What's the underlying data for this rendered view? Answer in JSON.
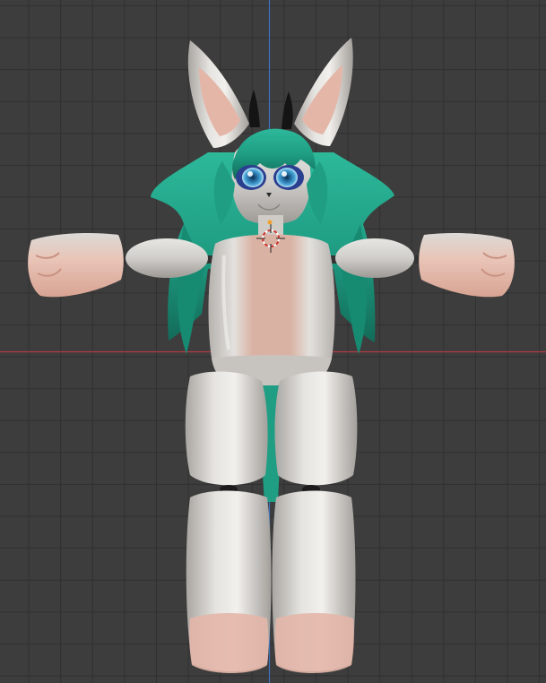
{
  "viewport": {
    "view": "front-orthographic",
    "grid": true,
    "colors": {
      "background": "#3d3d3d",
      "grid_line": "#303030",
      "x_axis": "#b23c46",
      "z_axis": "#3f6fbf",
      "cursor_red": "#d0342c",
      "cursor_white": "#ffffff"
    }
  },
  "model": {
    "description_colors": {
      "body_white": "#dcdad6",
      "body_shade": "#a9a6a2",
      "skin_pink": "#e6b7a8",
      "hair_teal": "#1f9e84",
      "hair_dark": "#126b58",
      "horn_black": "#141414",
      "eye_blue": "#4aa6d8",
      "eye_ring": "#2a3f8f"
    }
  }
}
